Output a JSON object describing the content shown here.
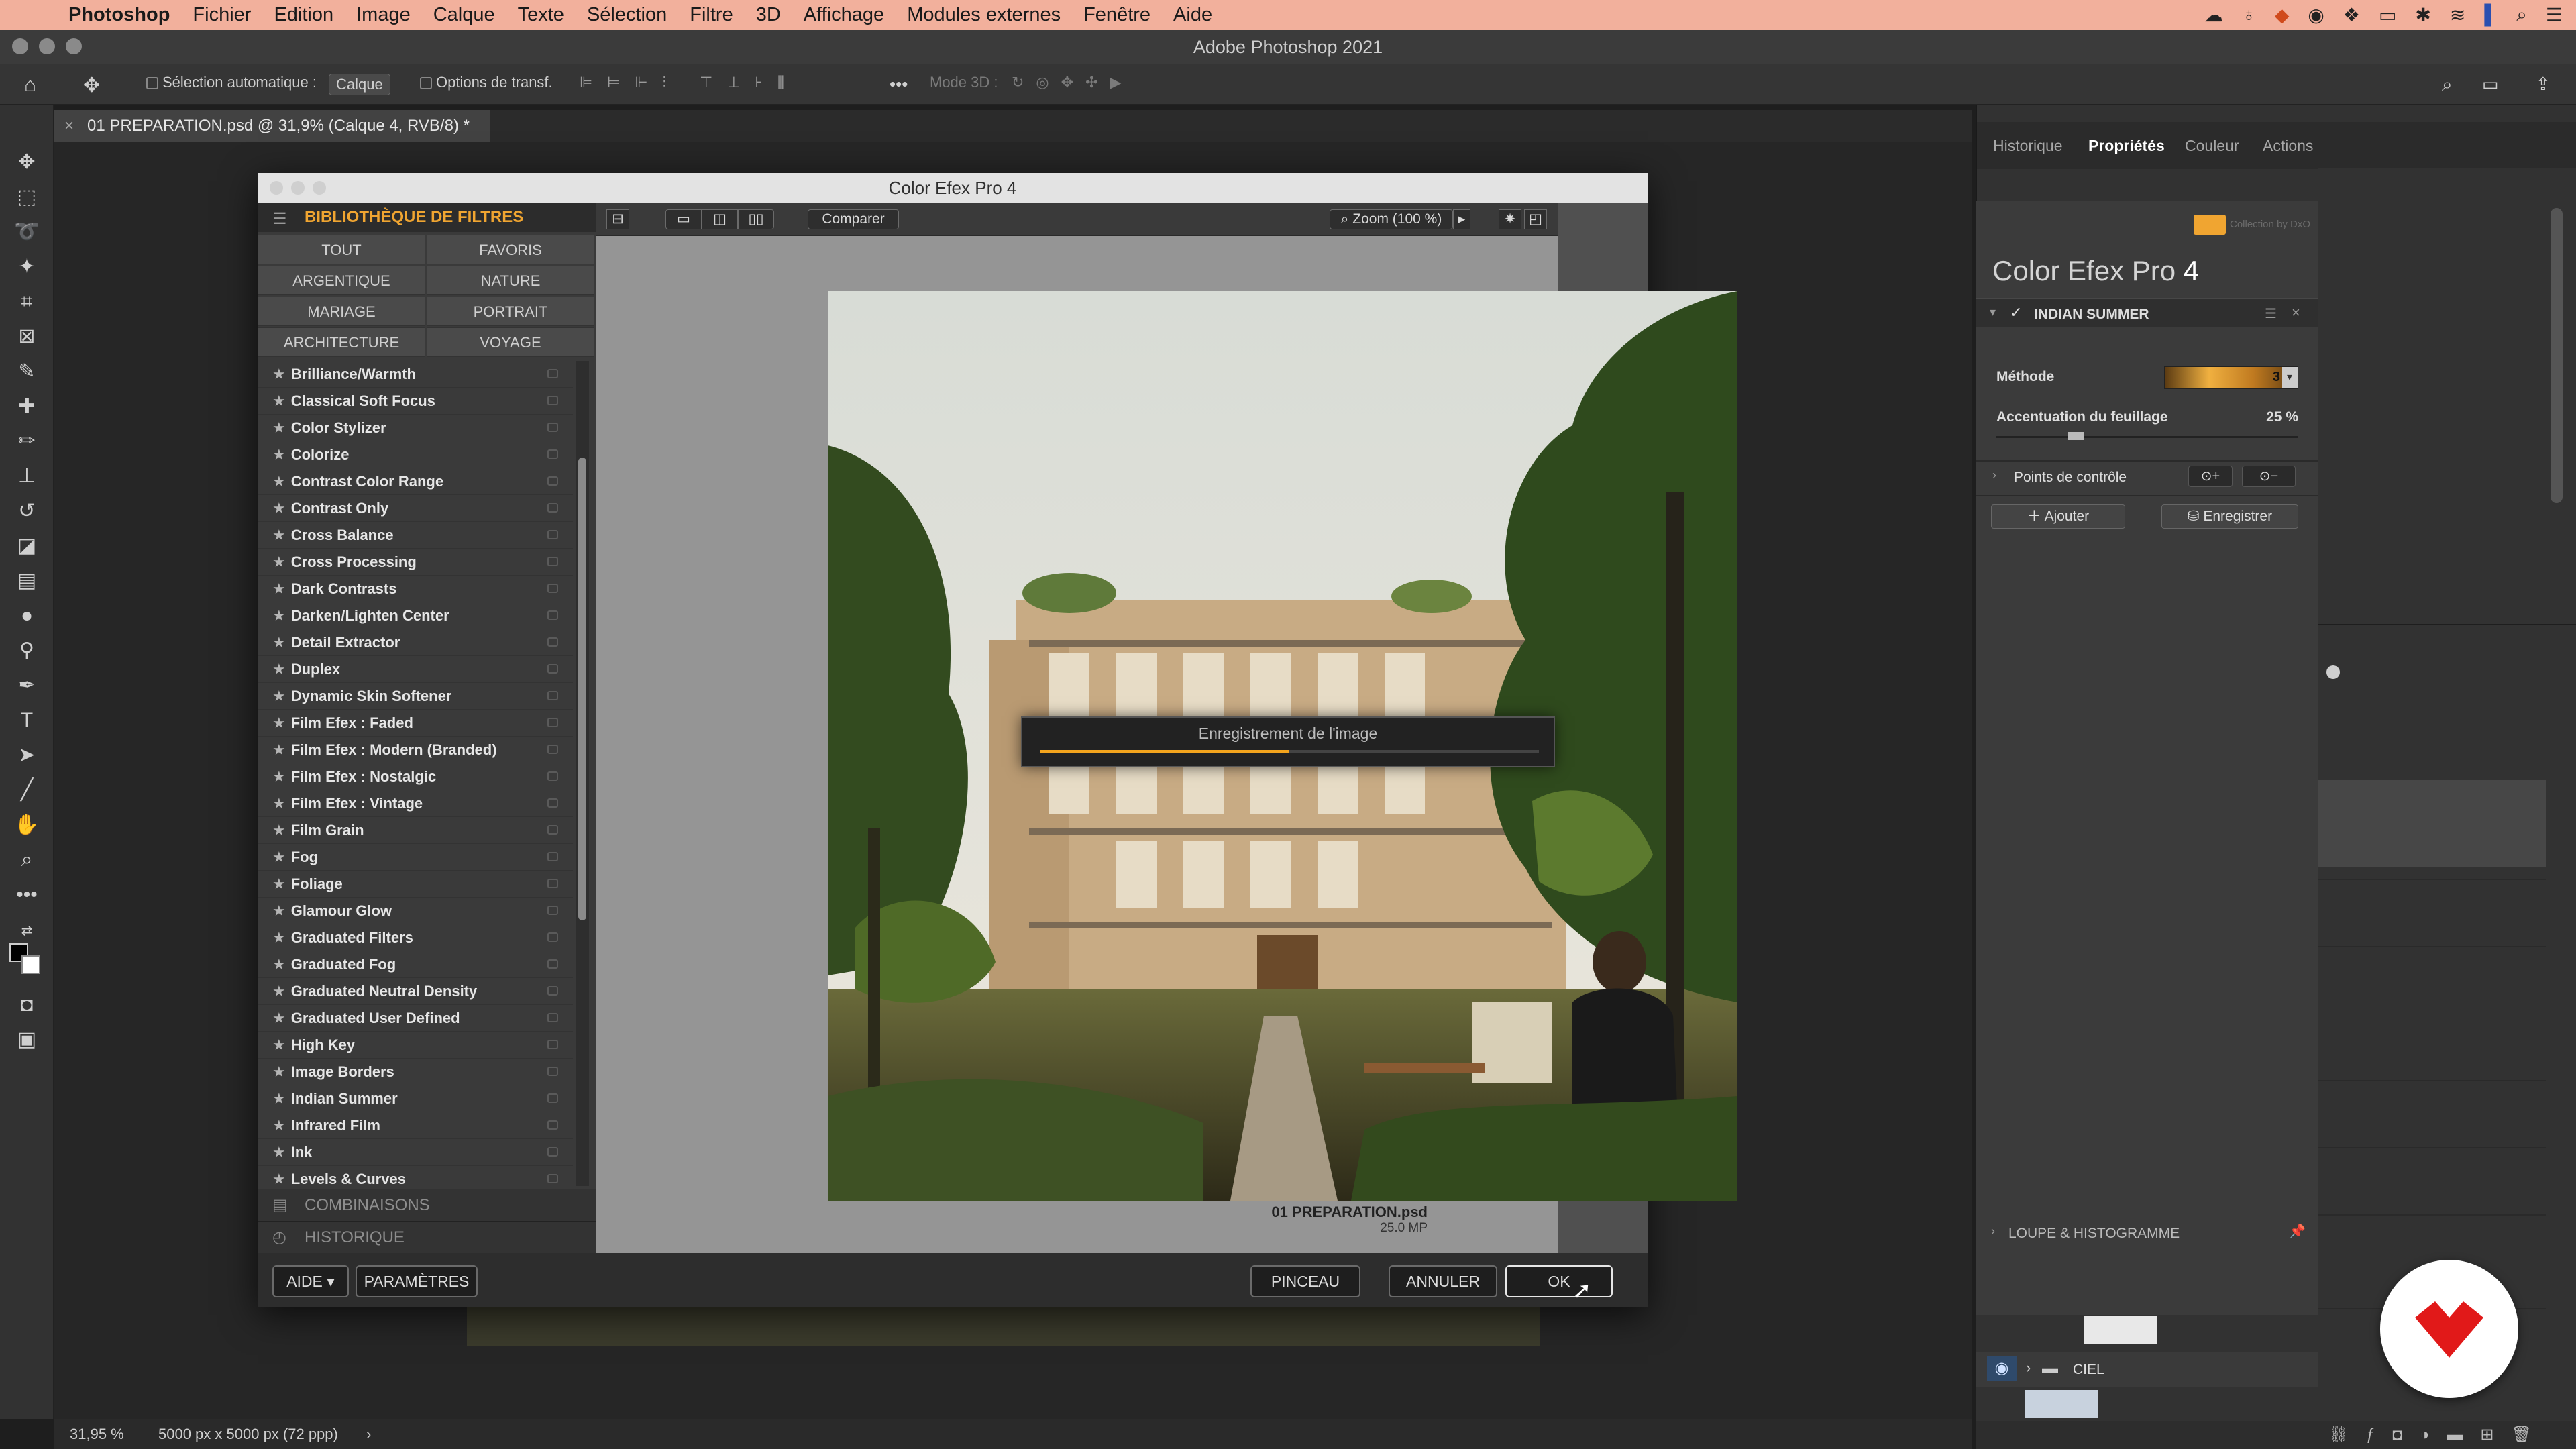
{
  "menubar": {
    "app": "Photoshop",
    "items": [
      "Fichier",
      "Edition",
      "Image",
      "Calque",
      "Texte",
      "Sélection",
      "Filtre",
      "3D",
      "Affichage",
      "Modules externes",
      "Fenêtre",
      "Aide"
    ]
  },
  "window": {
    "title": "Adobe Photoshop 2021"
  },
  "options": {
    "auto_select": "Sélection automatique :",
    "layer_mode": "Calque",
    "transform": "Options de transf.",
    "mode3d": "Mode 3D :"
  },
  "document_tab": "01 PREPARATION.psd @ 31,9% (Calque 4, RVB/8) *",
  "status": {
    "zoom": "31,95 %",
    "size": "5000 px x 5000 px (72 ppp)"
  },
  "right_tabs": [
    "Historique",
    "Propriétés",
    "Couleur",
    "Actions"
  ],
  "dialog": {
    "title": "Color Efex Pro 4",
    "library_title": "BIBLIOTHÈQUE DE FILTRES",
    "categories": [
      "TOUT",
      "FAVORIS",
      "ARGENTIQUE",
      "NATURE",
      "MARIAGE",
      "PORTRAIT",
      "ARCHITECTURE",
      "VOYAGE"
    ],
    "filters": [
      "Brilliance/Warmth",
      "Classical Soft Focus",
      "Color Stylizer",
      "Colorize",
      "Contrast Color Range",
      "Contrast Only",
      "Cross Balance",
      "Cross Processing",
      "Dark Contrasts",
      "Darken/Lighten Center",
      "Detail Extractor",
      "Duplex",
      "Dynamic Skin Softener",
      "Film Efex : Faded",
      "Film Efex : Modern (Branded)",
      "Film Efex : Nostalgic",
      "Film Efex : Vintage",
      "Film Grain",
      "Fog",
      "Foliage",
      "Glamour Glow",
      "Graduated Filters",
      "Graduated Fog",
      "Graduated Neutral Density",
      "Graduated User Defined",
      "High Key",
      "Image Borders",
      "Indian Summer",
      "Infrared Film",
      "Ink",
      "Levels & Curves"
    ],
    "combinations": "COMBINAISONS",
    "history": "HISTORIQUE",
    "compare": "Comparer",
    "zoom": "Zoom (100 %)",
    "file_name": "01 PREPARATION.psd",
    "file_mp": "25.0 MP",
    "progress_label": "Enregistrement de l'image",
    "progress": 0.5,
    "help": "AIDE",
    "settings": "PARAMÈTRES",
    "brush": "PINCEAU",
    "cancel": "ANNULER",
    "ok": "OK"
  },
  "fx": {
    "brand_title": "Color Efex Pro",
    "brand_number": "4",
    "nik_collection": "Collection by DxO",
    "filter_name": "INDIAN SUMMER",
    "method_label": "Méthode",
    "method_value": "3",
    "foliage_label": "Accentuation du feuillage",
    "foliage_value": "25 %",
    "control_points": "Points de contrôle",
    "add": "Ajouter",
    "save": "Enregistrer",
    "loupe": "LOUPE & HISTOGRAMME"
  },
  "layers": {
    "ciel": "CIEL"
  },
  "colors": {
    "accent": "#f0a531",
    "progress": "#f3a41d",
    "menubar": "#f2b09c",
    "badge_red": "#e11919"
  }
}
